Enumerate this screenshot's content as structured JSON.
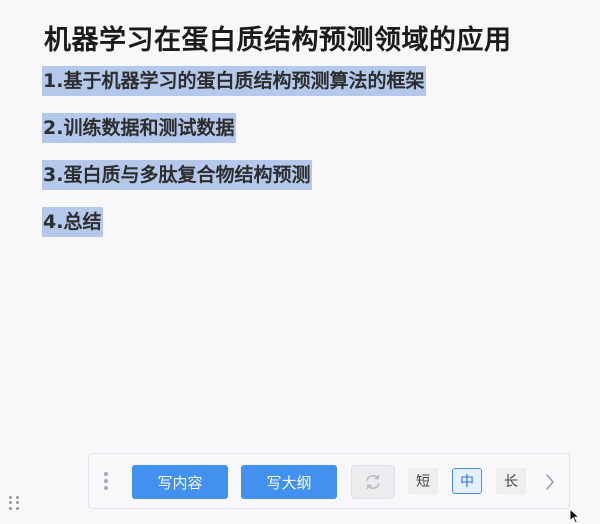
{
  "document": {
    "title": "机器学习在蛋白质结构预测领域的应用",
    "outline": [
      "1.基于机器学习的蛋白质结构预测算法的框架",
      "2.训练数据和测试数据",
      "3.蛋白质与多肽复合物结构预测",
      "4.总结"
    ]
  },
  "toolbar": {
    "write_content_label": "写内容",
    "write_outline_label": "写大纲",
    "length_short": "短",
    "length_medium": "中",
    "length_long": "长",
    "selected_length": "中"
  },
  "colors": {
    "primary": "#4290f0",
    "highlight": "#b3c8ea",
    "selected_border": "#4c8df0"
  },
  "icons": [
    "drag-handle-icon",
    "refresh-icon",
    "chevron-right-icon",
    "mouse-cursor-icon"
  ]
}
